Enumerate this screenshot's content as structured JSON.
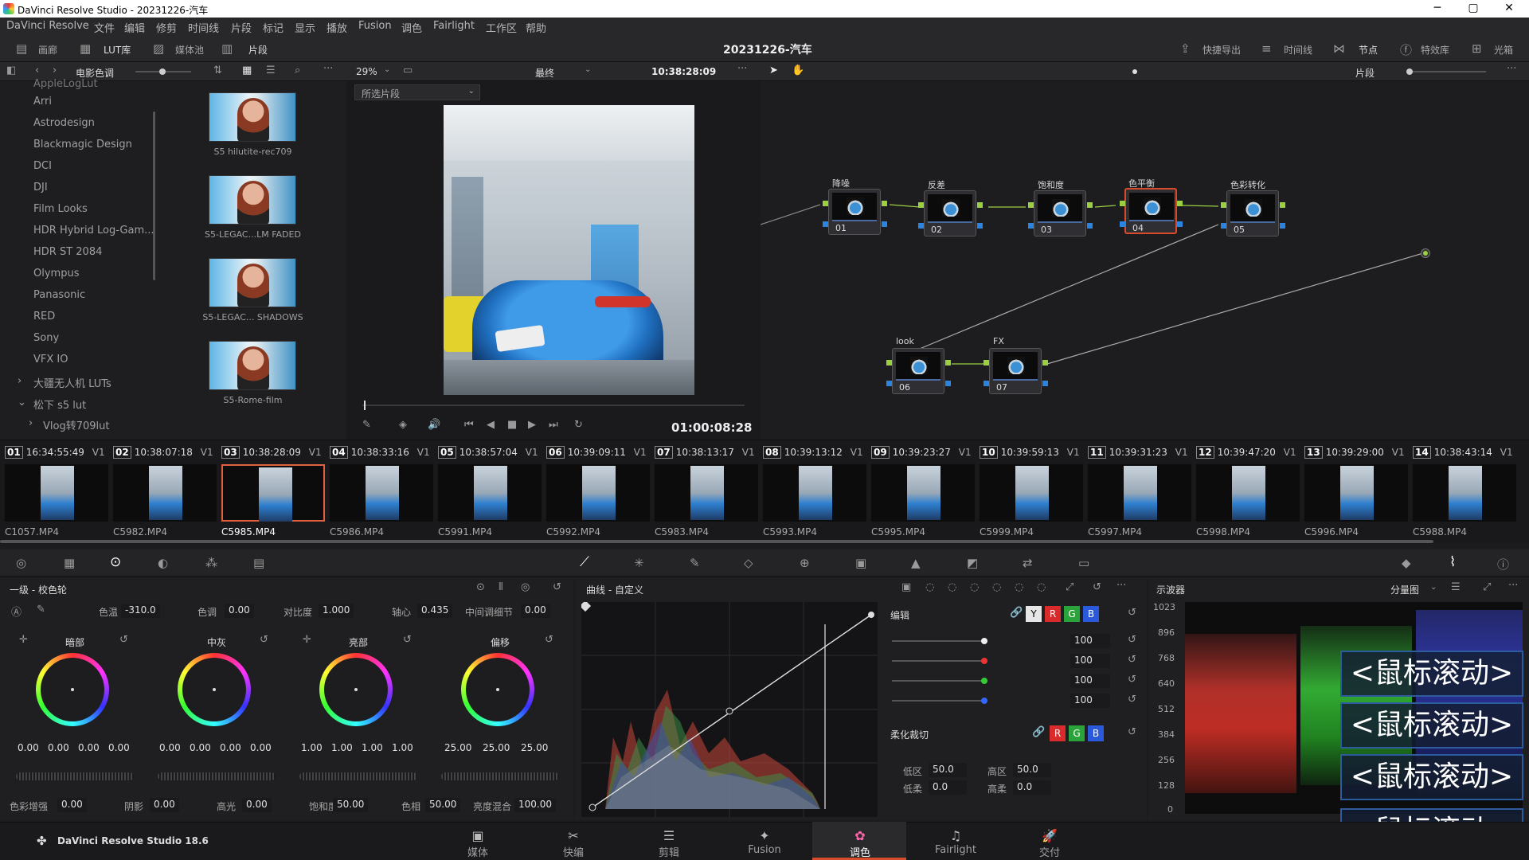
{
  "window": {
    "title": "DaVinci Resolve Studio - 20231226-汽车",
    "min": "─",
    "max": "▢",
    "close": "✕"
  },
  "menu": [
    "DaVinci Resolve",
    "文件",
    "编辑",
    "修剪",
    "时间线",
    "片段",
    "标记",
    "显示",
    "播放",
    "Fusion",
    "调色",
    "Fairlight",
    "工作区",
    "帮助"
  ],
  "toolbar": {
    "left": [
      "画廊",
      "LUT库",
      "媒体池",
      "片段"
    ],
    "project_title": "20231226-汽车",
    "right": [
      "快捷导出",
      "时间线",
      "节点",
      "特效库",
      "光箱"
    ]
  },
  "subbar": {
    "panel_name": "电影色调",
    "zoom": "29%",
    "mode": "最终",
    "timecode": "10:38:28:09",
    "clip_mode": "片段",
    "clip_filter": "所选片段"
  },
  "lut_tree": {
    "top_partial": "AppleLogLut",
    "items": [
      "Arri",
      "Astrodesign",
      "Blackmagic Design",
      "DCI",
      "DJI",
      "Film Looks",
      "HDR Hybrid Log-Gam...",
      "HDR ST 2084",
      "Olympus",
      "Panasonic",
      "RED",
      "Sony",
      "VFX IO"
    ],
    "groups": [
      "大疆无人机 LUTs",
      "松下 s5 lut"
    ],
    "sub": "Vlog转709lut"
  },
  "lut_thumbs": [
    "S5 hilutite-rec709",
    "S5-LEGAC...LM FADED",
    "S5-LEGAC... SHADOWS",
    "S5-Rome-film"
  ],
  "viewer": {
    "timecode": "01:00:08:28"
  },
  "nodes": [
    {
      "label": "降噪",
      "num": "01"
    },
    {
      "label": "反差",
      "num": "02"
    },
    {
      "label": "饱和度",
      "num": "03"
    },
    {
      "label": "色平衡",
      "num": "04"
    },
    {
      "label": "色彩转化",
      "num": "05"
    },
    {
      "label": "look",
      "num": "06"
    },
    {
      "label": "FX",
      "num": "07"
    }
  ],
  "clips": [
    {
      "n": "01",
      "tc": "16:34:55:49",
      "v": "V1",
      "name": "C1057.MP4"
    },
    {
      "n": "02",
      "tc": "10:38:07:18",
      "v": "V1",
      "name": "C5982.MP4"
    },
    {
      "n": "03",
      "tc": "10:38:28:09",
      "v": "V1",
      "name": "C5985.MP4"
    },
    {
      "n": "04",
      "tc": "10:38:33:16",
      "v": "V1",
      "name": "C5986.MP4"
    },
    {
      "n": "05",
      "tc": "10:38:57:04",
      "v": "V1",
      "name": "C5991.MP4"
    },
    {
      "n": "06",
      "tc": "10:39:09:11",
      "v": "V1",
      "name": "C5992.MP4"
    },
    {
      "n": "07",
      "tc": "10:38:13:17",
      "v": "V1",
      "name": "C5983.MP4"
    },
    {
      "n": "08",
      "tc": "10:39:13:12",
      "v": "V1",
      "name": "C5993.MP4"
    },
    {
      "n": "09",
      "tc": "10:39:23:27",
      "v": "V1",
      "name": "C5995.MP4"
    },
    {
      "n": "10",
      "tc": "10:39:59:13",
      "v": "V1",
      "name": "C5999.MP4"
    },
    {
      "n": "11",
      "tc": "10:39:31:23",
      "v": "V1",
      "name": "C5997.MP4"
    },
    {
      "n": "12",
      "tc": "10:39:47:20",
      "v": "V1",
      "name": "C5998.MP4"
    },
    {
      "n": "13",
      "tc": "10:39:29:00",
      "v": "V1",
      "name": "C5996.MP4"
    },
    {
      "n": "14",
      "tc": "10:38:43:14",
      "v": "V1",
      "name": "C5988.MP4"
    }
  ],
  "primaries": {
    "title": "一级 - 校色轮",
    "top": [
      {
        "label": "色温",
        "value": "-310.0"
      },
      {
        "label": "色调",
        "value": "0.00"
      },
      {
        "label": "对比度",
        "value": "1.000"
      },
      {
        "label": "轴心",
        "value": "0.435"
      },
      {
        "label": "中间调细节",
        "value": "0.00"
      }
    ],
    "wheels": [
      {
        "label": "暗部",
        "values": [
          "0.00",
          "0.00",
          "0.00",
          "0.00"
        ]
      },
      {
        "label": "中灰",
        "values": [
          "0.00",
          "0.00",
          "0.00",
          "0.00"
        ]
      },
      {
        "label": "亮部",
        "values": [
          "1.00",
          "1.00",
          "1.00",
          "1.00"
        ]
      },
      {
        "label": "偏移",
        "values": [
          "25.00",
          "25.00",
          "25.00"
        ]
      }
    ],
    "bottom": [
      {
        "label": "色彩增强",
        "value": "0.00"
      },
      {
        "label": "阴影",
        "value": "0.00"
      },
      {
        "label": "高光",
        "value": "0.00"
      },
      {
        "label": "饱和度",
        "value": "50.00"
      },
      {
        "label": "色相",
        "value": "50.00"
      },
      {
        "label": "亮度混合",
        "value": "100.00"
      }
    ]
  },
  "curves": {
    "title": "曲线 - 自定义",
    "edit_label": "编辑",
    "channels": [
      "Y",
      "R",
      "G",
      "B"
    ],
    "intensity": [
      "100",
      "100",
      "100",
      "100"
    ],
    "soft_clip_label": "柔化裁切",
    "soft": [
      {
        "label": "低区",
        "value": "50.0"
      },
      {
        "label": "高区",
        "value": "50.0"
      },
      {
        "label": "低柔",
        "value": "0.0"
      },
      {
        "label": "高柔",
        "value": "0.0"
      }
    ]
  },
  "scope": {
    "title": "示波器",
    "mode": "分量图",
    "ticks": [
      "1023",
      "896",
      "768",
      "640",
      "512",
      "384",
      "256",
      "128",
      "0"
    ],
    "overlay": "<鼠标滚动>"
  },
  "footer": {
    "brand": "DaVinci Resolve Studio 18.6",
    "pages": [
      "媒体",
      "快编",
      "剪辑",
      "Fusion",
      "调色",
      "Fairlight",
      "交付"
    ],
    "active": "调色"
  },
  "colors": {
    "accent": "#d84c2b",
    "node_green": "#9ad042",
    "node_blue": "#2a84e0",
    "panel": "#1c1c1e"
  }
}
